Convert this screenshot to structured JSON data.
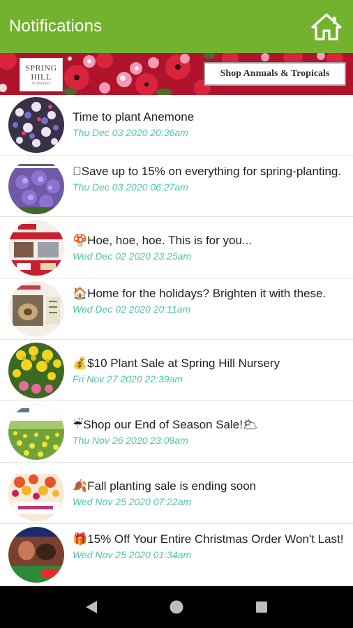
{
  "appbar": {
    "title": "Notifications"
  },
  "banner": {
    "logo_line1": "SPRING",
    "logo_line2": "HILL",
    "logo_line3": "NURSERIES",
    "cta_label": "Shop Annuals & Tropicals"
  },
  "notifications": [
    {
      "message": "Time to plant Anemone",
      "date": "Thu Dec 03 2020 20:36am"
    },
    {
      "message": "\u0000Save up to 15% on everything for spring-planting.",
      "date": "Thu Dec 03 2020 06:27am"
    },
    {
      "message": "🍄Hoe, hoe, hoe. This is for you...",
      "date": "Wed Dec 02 2020 23:25am"
    },
    {
      "message": "🏠Home for the holidays? Brighten it with these.",
      "date": "Wed Dec 02 2020 20:11am"
    },
    {
      "message": "💰$10 Plant Sale at Spring Hill Nursery",
      "date": "Fri Nov 27 2020 22:39am"
    },
    {
      "message": "☔Shop our End of Season Sale!🌥",
      "date": "Thu Nov 26 2020 23:09am"
    },
    {
      "message": "🍂Fall planting sale is ending soon",
      "date": "Wed Nov 25 2020 07:22am"
    },
    {
      "message": "🎁15% Off Your Entire Christmas Order Won't Last!",
      "date": "Wed Nov 25 2020 01:34am"
    }
  ],
  "icons": {
    "home": "home-icon",
    "back": "back-icon",
    "home_nav": "home-circle-icon",
    "recents": "recents-icon"
  },
  "colors": {
    "appbar": "#73b22f",
    "date_text": "#4fc5a9",
    "navbar": "#000000"
  }
}
